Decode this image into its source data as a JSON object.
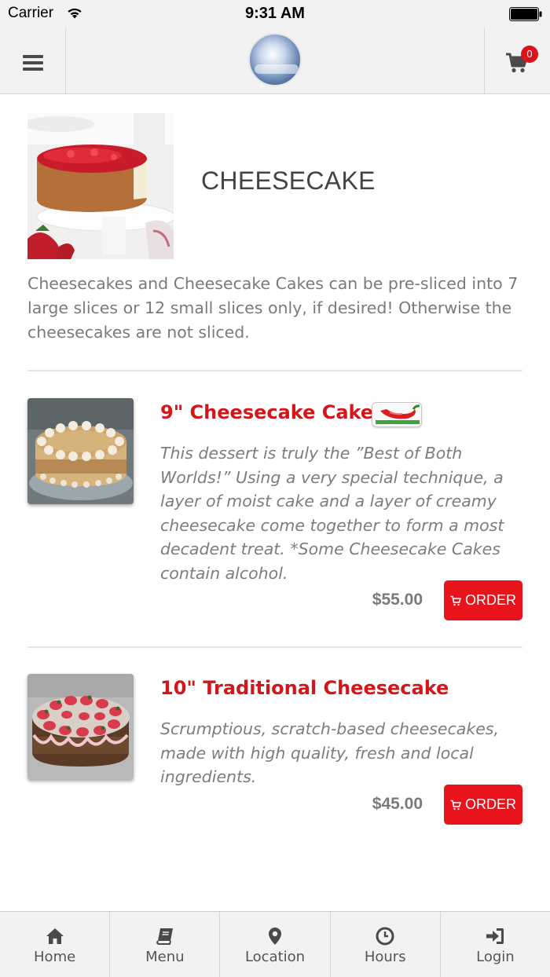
{
  "status_bar": {
    "carrier": "Carrier",
    "time": "9:31 AM"
  },
  "header": {
    "cart_count": "0",
    "menu_icon": "hamburger-icon",
    "cart_icon": "shopping-cart-icon"
  },
  "category": {
    "title": "CHEESECAKE",
    "description": "Cheesecakes and Cheesecake Cakes can be pre-sliced into 7 large slices or 12 small slices only, if desired! Otherwise the cheesecakes are not sliced."
  },
  "items": [
    {
      "name": "9\" Cheesecake Cakes",
      "description": "This dessert is truly the ”Best of Both Worlds!” Using a very special technique, a layer of moist cake and a layer of creamy cheesecake come together to form a most decadent treat. *Some Cheesecake Cakes contain alcohol.",
      "price": "$55.00",
      "order_label": "ORDER",
      "badge_icon": "chili-pepper-icon"
    },
    {
      "name": "10\" Traditional Cheesecake",
      "description": "Scrumptious, scratch-based cheesecakes, made with high quality, fresh and local ingredients.",
      "price": "$45.00",
      "order_label": "ORDER"
    }
  ],
  "bottom_nav": [
    {
      "label": "Home",
      "icon": "home-icon"
    },
    {
      "label": "Menu",
      "icon": "book-icon"
    },
    {
      "label": "Location",
      "icon": "map-pin-icon"
    },
    {
      "label": "Hours",
      "icon": "clock-icon"
    },
    {
      "label": "Login",
      "icon": "login-icon"
    }
  ],
  "colors": {
    "accent": "#e8141b",
    "item_title": "#d4161b",
    "bar_background": "#f2f2f2"
  }
}
